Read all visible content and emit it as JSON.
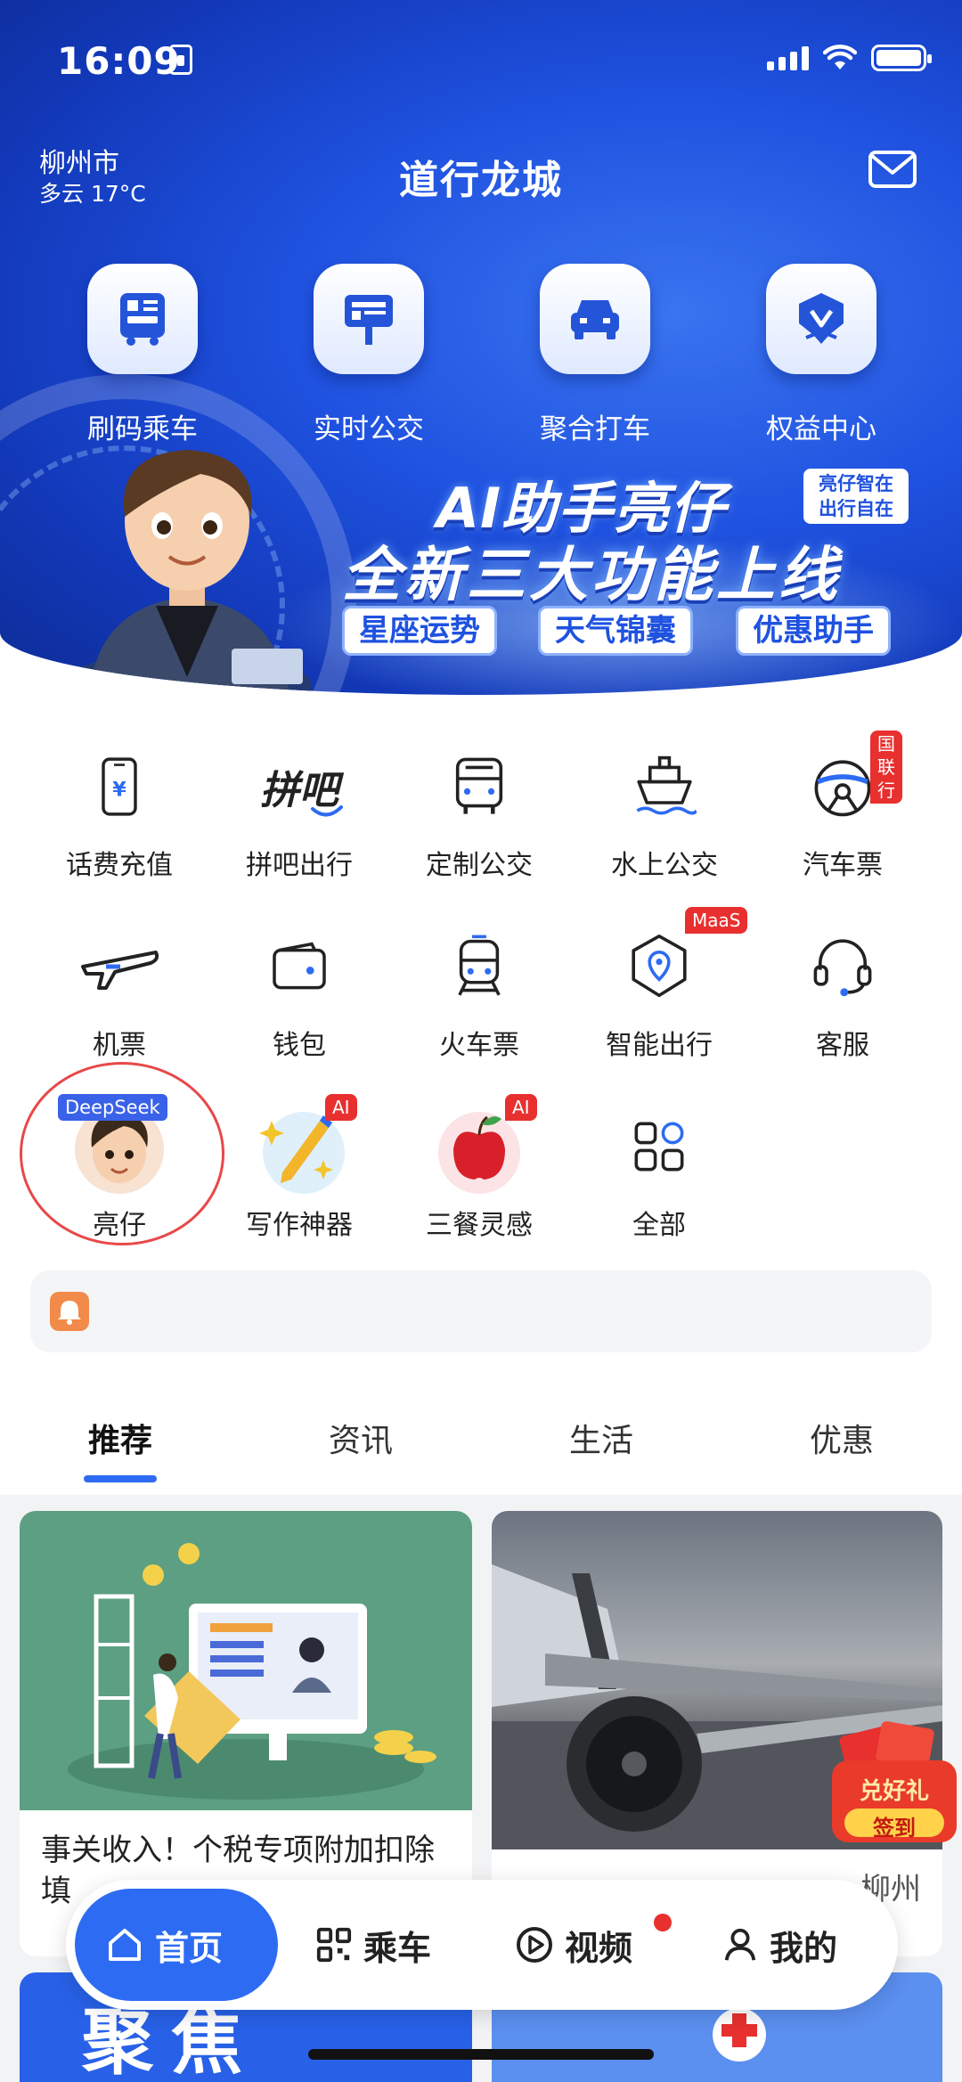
{
  "status_bar": {
    "time": "16:09"
  },
  "header": {
    "city": "柳州市",
    "weather": "多云 17°C",
    "title": "道行龙城"
  },
  "quick_actions": [
    {
      "label": "刷码乘车",
      "icon": "qr-bus-icon"
    },
    {
      "label": "实时公交",
      "icon": "bus-stop-sign-icon"
    },
    {
      "label": "聚合打车",
      "icon": "car-icon"
    },
    {
      "label": "权益中心",
      "icon": "shield-v-icon"
    }
  ],
  "banner": {
    "line1": "AI助手亮仔",
    "tag_line1": "亮仔智在",
    "tag_line2": "出行自在",
    "line2": "全新三大功能上线",
    "pills": [
      "星座运势",
      "天气锦囊",
      "优惠助手"
    ]
  },
  "services": [
    {
      "label": "话费充值",
      "icon": "phone-recharge-icon"
    },
    {
      "label": "拼吧出行",
      "icon": "pinba-logo-icon",
      "logo_text": "拼吧"
    },
    {
      "label": "定制公交",
      "icon": "bus-icon"
    },
    {
      "label": "水上公交",
      "icon": "ship-icon"
    },
    {
      "label": "汽车票",
      "icon": "steering-wheel-icon",
      "badge": "国联行"
    },
    {
      "label": "机票",
      "icon": "airplane-icon"
    },
    {
      "label": "钱包",
      "icon": "wallet-icon"
    },
    {
      "label": "火车票",
      "icon": "train-icon"
    },
    {
      "label": "智能出行",
      "icon": "location-pin-icon",
      "badge": "MaaS"
    },
    {
      "label": "客服",
      "icon": "headset-icon"
    },
    {
      "label": "亮仔",
      "icon": "avatar-icon",
      "badge": "DeepSeek"
    },
    {
      "label": "写作神器",
      "icon": "pen-sparkle-icon",
      "badge": "AI"
    },
    {
      "label": "三餐灵感",
      "icon": "apple-icon",
      "badge": "AI"
    },
    {
      "label": "全部",
      "icon": "grid-apps-icon"
    }
  ],
  "tabs": [
    "推荐",
    "资讯",
    "生活",
    "优惠"
  ],
  "active_tab": "推荐",
  "feed": {
    "card1_title": "事关收入！个税专项附加扣除填",
    "card2_title": "柳州",
    "redpacket_line1": "兑好礼",
    "redpacket_line2": "签到"
  },
  "bottom_peek": {
    "left_text": "聚焦"
  },
  "nav": [
    {
      "label": "首页",
      "icon": "home-icon"
    },
    {
      "label": "乘车",
      "icon": "qr-code-icon"
    },
    {
      "label": "视频",
      "icon": "play-circle-icon"
    },
    {
      "label": "我的",
      "icon": "person-icon"
    }
  ],
  "colors": {
    "brand": "#2d6cf2",
    "hero_blue": "#1f52e0",
    "badge_red": "#e8302f"
  }
}
